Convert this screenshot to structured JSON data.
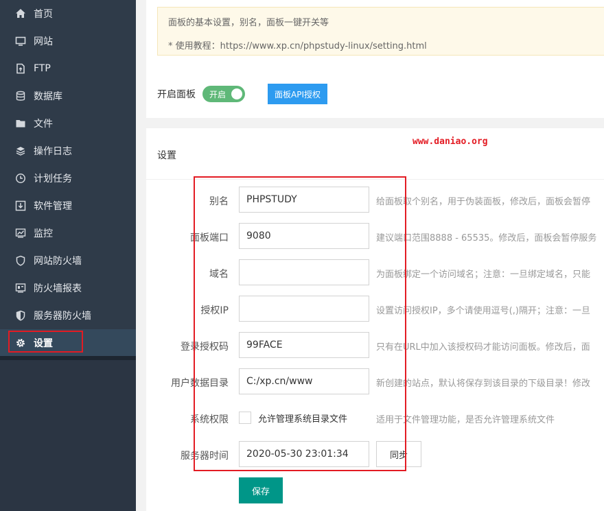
{
  "sidebar": {
    "items": [
      {
        "label": "首页",
        "icon": "home-icon"
      },
      {
        "label": "网站",
        "icon": "monitor-icon"
      },
      {
        "label": "FTP",
        "icon": "ftp-icon"
      },
      {
        "label": "数据库",
        "icon": "database-icon"
      },
      {
        "label": "文件",
        "icon": "folder-icon"
      },
      {
        "label": "操作日志",
        "icon": "layers-icon"
      },
      {
        "label": "计划任务",
        "icon": "clock-icon"
      },
      {
        "label": "软件管理",
        "icon": "download-icon"
      },
      {
        "label": "监控",
        "icon": "chart-icon"
      },
      {
        "label": "网站防火墙",
        "icon": "shield-icon"
      },
      {
        "label": "防火墙报表",
        "icon": "report-icon"
      },
      {
        "label": "服务器防火墙",
        "icon": "shield-half-icon"
      },
      {
        "label": "设置",
        "icon": "gear-icon"
      }
    ],
    "active_index": 12
  },
  "notice": {
    "line1": "面板的基本设置，别名，面板一键开关等",
    "line2": "* 使用教程：https://www.xp.cn/phpstudy-linux/setting.html"
  },
  "panel": {
    "label": "开启面板",
    "toggle_text": "开启",
    "toggle_on": true,
    "api_button": "面板API授权"
  },
  "settings": {
    "title": "设置",
    "watermark": "www.daniao.org",
    "alias": {
      "label": "别名",
      "value": "PHPSTUDY",
      "hint": "给面板取个别名，用于伪装面板，修改后，面板会暂停"
    },
    "port": {
      "label": "面板端口",
      "value": "9080",
      "hint": "建议端口范围8888 - 65535。修改后，面板会暂停服务"
    },
    "domain": {
      "label": "域名",
      "value": "",
      "hint": "为面板绑定一个访问域名；注意：一旦绑定域名，只能"
    },
    "auth_ip": {
      "label": "授权IP",
      "value": "",
      "hint": "设置访问授权IP，多个请使用逗号(,)隔开；注意：一旦"
    },
    "login_code": {
      "label": "登录授权码",
      "value": "99FACE",
      "hint": "只有在URL中加入该授权码才能访问面板。修改后，面"
    },
    "data_dir": {
      "label": "用户数据目录",
      "value": "C:/xp.cn/www",
      "hint": "新创建的站点，默认将保存到该目录的下级目录！修改"
    },
    "sys_perm": {
      "label": "系统权限",
      "checkbox_label": "允许管理系统目录文件",
      "checked": false,
      "hint": "适用于文件管理功能，是否允许管理系统文件"
    },
    "server_time": {
      "label": "服务器时间",
      "value": "2020-05-30 23:01:34",
      "sync_label": "同步"
    },
    "save_label": "保存"
  },
  "colors": {
    "sidebar": "#2f3b49",
    "toggle_on": "#5fb878",
    "api_button": "#2d9bf0",
    "save_button": "#009688",
    "annotation_red": "#e31b23"
  }
}
